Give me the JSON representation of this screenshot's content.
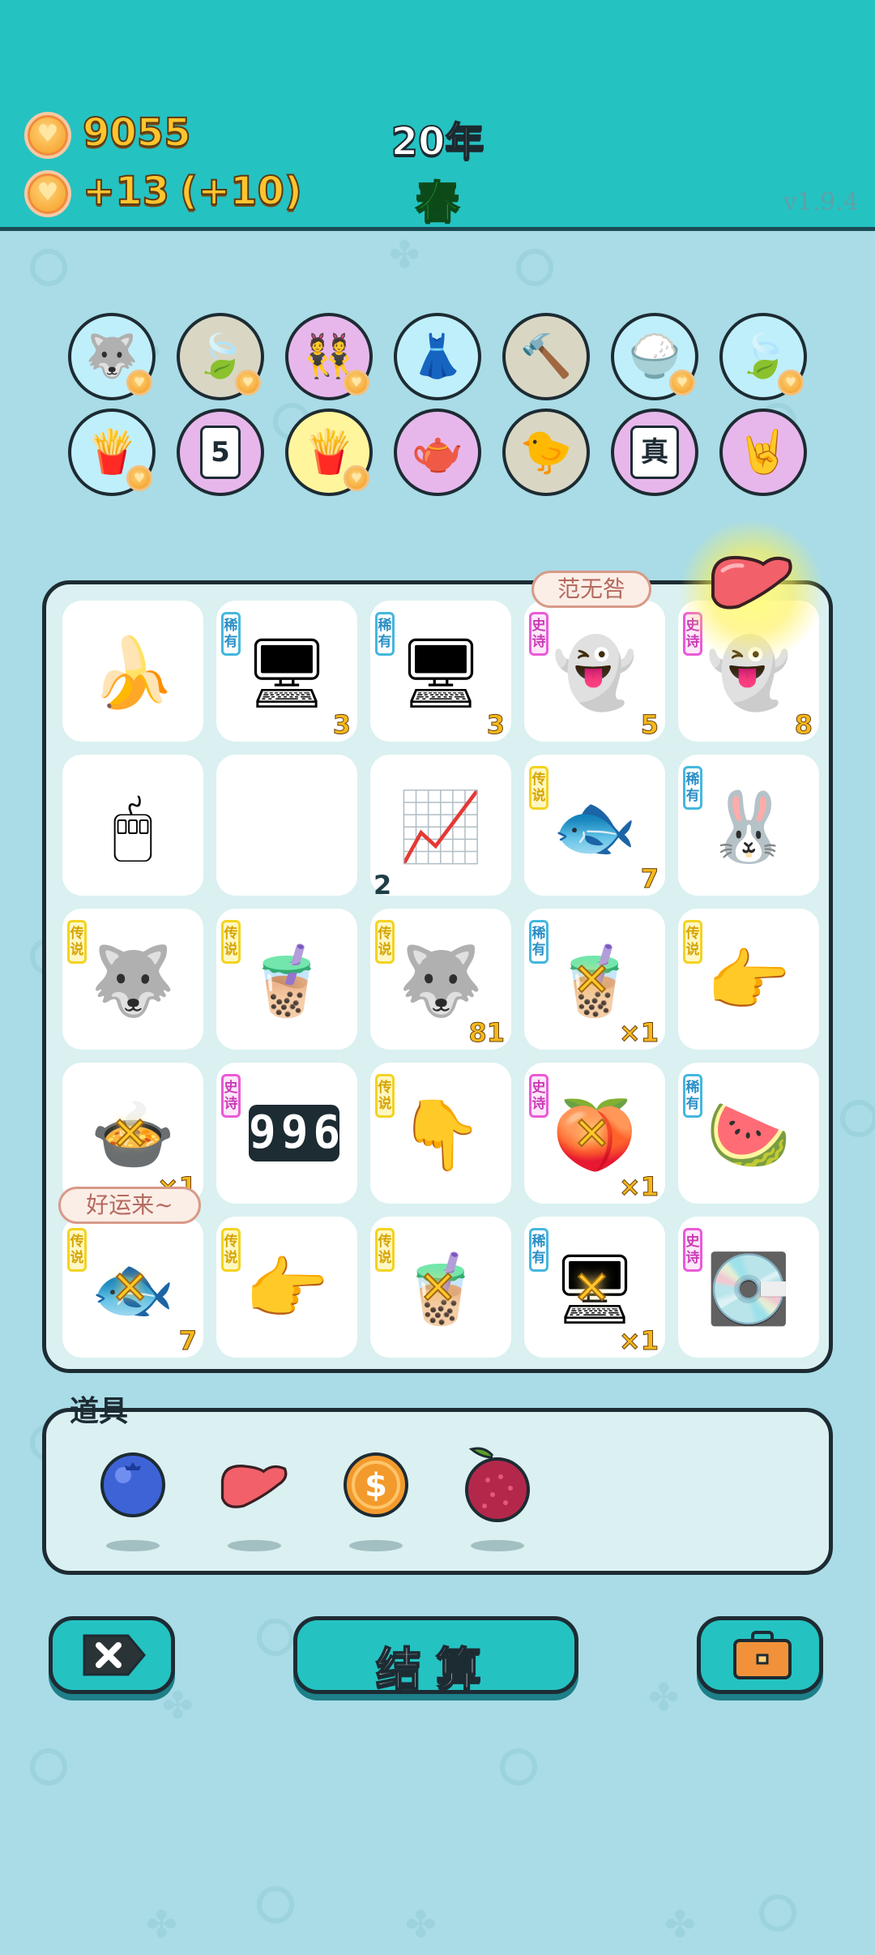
{
  "header": {
    "gold": "9055",
    "income": "+13",
    "income_bonus": "(+10)",
    "year": "20年",
    "season": "春",
    "version": "v1.9.4"
  },
  "relics": [
    {
      "name": "husky-icon",
      "bg": "#bfeffa",
      "badge": true
    },
    {
      "name": "leaf-icon",
      "bg": "#d9d7c4",
      "badge": true
    },
    {
      "name": "twins-icon",
      "bg": "#e7b7ec",
      "badge": true
    },
    {
      "name": "skirt-icon",
      "bg": "#bfeffa",
      "badge": false
    },
    {
      "name": "hammer-icon",
      "bg": "#d9d7c4",
      "badge": false
    },
    {
      "name": "rice-bowl-icon",
      "bg": "#bfeffa",
      "badge": true
    },
    {
      "name": "leaf-icon",
      "bg": "#bfeffa",
      "badge": true
    },
    {
      "name": "fries-icon",
      "bg": "#bfeffa",
      "badge": true
    },
    {
      "name": "calendar-icon",
      "bg": "#e7b7ec",
      "badge": false,
      "text": "5"
    },
    {
      "name": "fries-icon",
      "bg": "#fff59c",
      "badge": true
    },
    {
      "name": "gravy-boat-icon",
      "bg": "#e7b7ec",
      "badge": false
    },
    {
      "name": "chick-egg-icon",
      "bg": "#d9d7c4",
      "badge": false
    },
    {
      "name": "jar-icon",
      "bg": "#e7b7ec",
      "badge": false,
      "text": "真"
    },
    {
      "name": "rock-hand-icon",
      "bg": "#e7b7ec",
      "badge": false
    }
  ],
  "board": {
    "rows": [
      [
        {
          "icon": "banana-icon",
          "tag": "",
          "count": ""
        },
        {
          "icon": "server-icon",
          "tag": "稀有",
          "tag_type": "rare",
          "count": "3"
        },
        {
          "icon": "server-icon",
          "tag": "稀有",
          "tag_type": "rare",
          "count": "3"
        },
        {
          "icon": "black-white-impermanence-icon",
          "tag": "史诗",
          "tag_type": "epic",
          "count": "5"
        },
        {
          "icon": "ghost-icon",
          "tag": "史诗",
          "tag_type": "epic",
          "count": "8"
        }
      ],
      [
        {
          "icon": "mouse-icon",
          "tag": "",
          "count": ""
        },
        {
          "icon": "empty",
          "tag": "",
          "count": ""
        },
        {
          "icon": "stock-chart-icon",
          "tag": "",
          "count": "2",
          "dark": true
        },
        {
          "icon": "koi-fish-icon",
          "tag": "传说",
          "tag_type": "legend",
          "count": "7"
        },
        {
          "icon": "rabbit-icon",
          "tag": "稀有",
          "tag_type": "rare",
          "count": ""
        }
      ],
      [
        {
          "icon": "husky-king-icon",
          "tag": "传说",
          "tag_type": "legend",
          "count": ""
        },
        {
          "icon": "milk-tea-icon",
          "tag": "传说",
          "tag_type": "legend",
          "count": ""
        },
        {
          "icon": "husky-coin-icon",
          "tag": "传说",
          "tag_type": "legend",
          "count": "81"
        },
        {
          "icon": "boba-cup-icon",
          "tag": "稀有",
          "tag_type": "rare",
          "count": "×1"
        },
        {
          "icon": "pointing-hand-icon",
          "tag": "传说",
          "tag_type": "legend",
          "count": ""
        }
      ],
      [
        {
          "icon": "soup-bowl-icon",
          "tag": "",
          "count": "×1"
        },
        {
          "icon": "996-icon",
          "tag": "史诗",
          "tag_type": "epic",
          "count": ""
        },
        {
          "icon": "pointing-down-hand-icon",
          "tag": "传说",
          "tag_type": "legend",
          "count": ""
        },
        {
          "icon": "peach-icon",
          "tag": "史诗",
          "tag_type": "epic",
          "count": "×1"
        },
        {
          "icon": "watermelon-icon",
          "tag": "稀有",
          "tag_type": "rare",
          "count": ""
        }
      ],
      [
        {
          "icon": "koi-fish-icon",
          "tag": "传说",
          "tag_type": "legend",
          "count": "7"
        },
        {
          "icon": "pointing-hand-icon",
          "tag": "传说",
          "tag_type": "legend",
          "count": ""
        },
        {
          "icon": "milk-tea-icon",
          "tag": "传说",
          "tag_type": "legend",
          "count": ""
        },
        {
          "icon": "server-icon",
          "tag": "稀有",
          "tag_type": "rare",
          "count": "×1"
        },
        {
          "icon": "gpu-icon",
          "tag": "史诗",
          "tag_type": "epic",
          "count": ""
        }
      ]
    ],
    "bubble_top": "范无咎",
    "bubble_left": "好运来~",
    "digits_996": "996"
  },
  "items": {
    "title": "道具",
    "list": [
      {
        "name": "blueberry-icon"
      },
      {
        "name": "liver-icon"
      },
      {
        "name": "dollar-coin-icon"
      },
      {
        "name": "lychee-icon"
      }
    ]
  },
  "buttons": {
    "settle_label": "结算"
  }
}
